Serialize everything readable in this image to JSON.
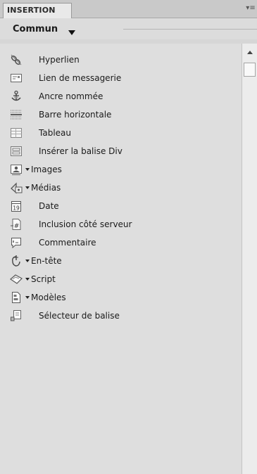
{
  "panel": {
    "tab_label": "INSERTION",
    "category": "Commun"
  },
  "items": [
    {
      "label": "Hyperlien",
      "icon": "hyperlink-icon",
      "dropdown": false
    },
    {
      "label": "Lien de messagerie",
      "icon": "email-link-icon",
      "dropdown": false
    },
    {
      "label": "Ancre nommée",
      "icon": "named-anchor-icon",
      "dropdown": false
    },
    {
      "label": "Barre horizontale",
      "icon": "horizontal-rule-icon",
      "dropdown": false
    },
    {
      "label": "Tableau",
      "icon": "table-icon",
      "dropdown": false
    },
    {
      "label": "Insérer la balise Div",
      "icon": "div-tag-icon",
      "dropdown": false
    },
    {
      "label": "Images",
      "icon": "image-icon",
      "dropdown": true
    },
    {
      "label": "Médias",
      "icon": "media-icon",
      "dropdown": true
    },
    {
      "label": "Date",
      "icon": "calendar-date-icon",
      "dropdown": false
    },
    {
      "label": "Inclusion côté serveur",
      "icon": "server-include-icon",
      "dropdown": false
    },
    {
      "label": "Commentaire",
      "icon": "comment-icon",
      "dropdown": false
    },
    {
      "label": "En-tête",
      "icon": "head-icon",
      "dropdown": true
    },
    {
      "label": "Script",
      "icon": "script-icon",
      "dropdown": true
    },
    {
      "label": "Modèles",
      "icon": "templates-icon",
      "dropdown": true
    },
    {
      "label": "Sélecteur de balise",
      "icon": "tag-chooser-icon",
      "dropdown": false
    }
  ]
}
